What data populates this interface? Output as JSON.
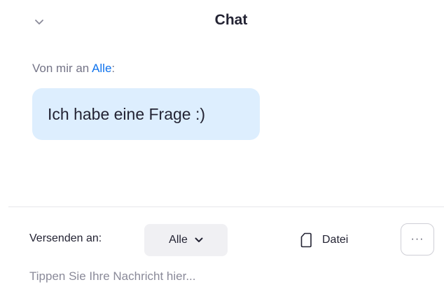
{
  "header": {
    "title": "Chat",
    "collapse_icon": "chevron-down-icon"
  },
  "message": {
    "sender_prefix": "Von mir an ",
    "recipient": "Alle",
    "suffix": ":",
    "text": "Ich habe eine Frage :)"
  },
  "footer": {
    "send_to_label": "Versenden an:",
    "recipient_selected": "Alle",
    "file_label": "Datei",
    "file_icon": "file-icon",
    "more_icon": "more-icon",
    "more_label": "···",
    "input_placeholder": "Tippen Sie Ihre Nachricht hier..."
  },
  "colors": {
    "accent": "#0e72ed",
    "bubble": "#ddeefe",
    "text": "#232333"
  }
}
